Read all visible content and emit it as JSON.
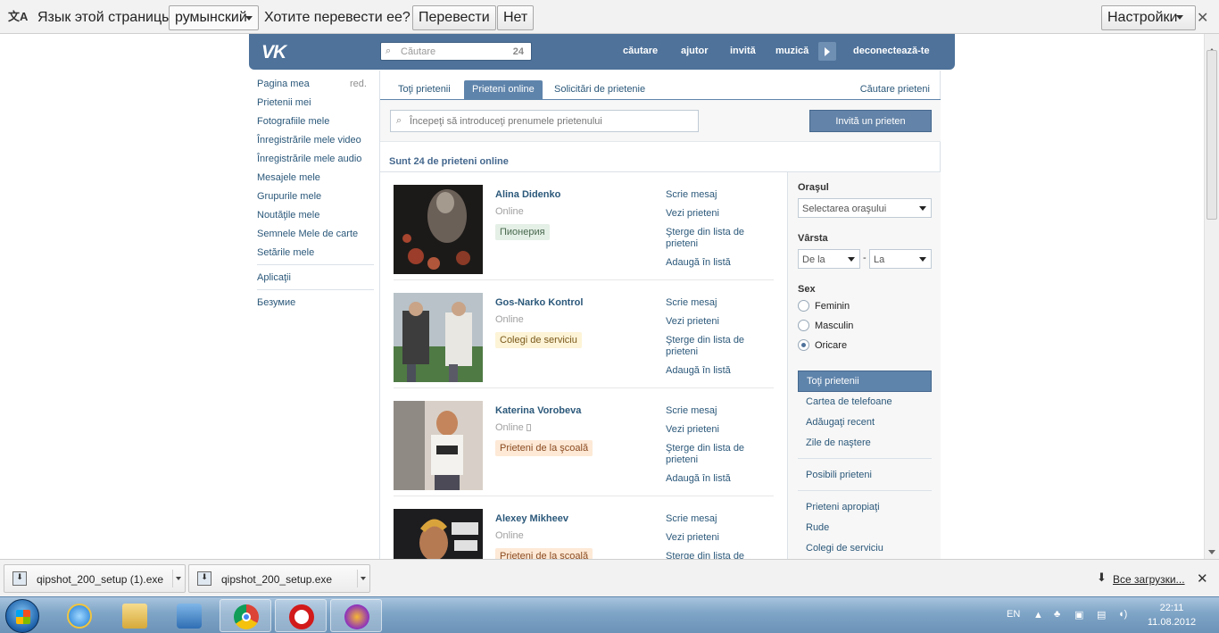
{
  "translate_bar": {
    "label": "Язык этой страницы",
    "language": "румынский",
    "question": "Хотите перевести ее?",
    "translate_btn": "Перевести",
    "no_btn": "Нет",
    "settings_btn": "Настройки",
    "close": "✕"
  },
  "header": {
    "logo": "VK",
    "search_placeholder": "Căutare",
    "search_count": "24",
    "nav": [
      "căutare",
      "ajutor",
      "invită",
      "muzică",
      "deconectează-te"
    ]
  },
  "sidebar": {
    "edit_label": "red.",
    "items": [
      "Pagina mea",
      "Prietenii mei",
      "Fotografiile mele",
      "Înregistrările mele video",
      "Înregistrările mele audio",
      "Mesajele mele",
      "Grupurile mele",
      "Noutăţile mele",
      "Semnele Mele de carte",
      "Setările mele",
      "Aplicaţii",
      "Безумие"
    ]
  },
  "tabs": {
    "items": [
      "Toţi prietenii",
      "Prieteni online",
      "Solicitări de prietenie"
    ],
    "active": "Prieteni online",
    "right": "Căutare prieteni"
  },
  "filter": {
    "placeholder": "Începeţi să introduceţi prenumele prietenului",
    "invite_btn": "Invită un prieten"
  },
  "summary": "Sunt 24 de prieteni online",
  "friends": [
    {
      "name": "Alina Didenko",
      "status": "Online",
      "tag": "Пионерия",
      "tag_bg": "#e4efe6",
      "tag_color": "#4a6a4f"
    },
    {
      "name": "Gos-Narko Kontrol",
      "status": "Online",
      "tag": "Colegi de serviciu",
      "tag_bg": "#fdf3d6",
      "tag_color": "#7a5a1c"
    },
    {
      "name": "Katerina Vorobeva",
      "status": "Online",
      "tag": "Prieteni de la şcoală",
      "tag_bg": "#fde9d6",
      "tag_color": "#8a4a20"
    },
    {
      "name": "Alexey Mikheev",
      "status": "Online",
      "tag": "Prieteni de la şcoală",
      "tag_bg": "#fde9d6",
      "tag_color": "#8a4a20"
    }
  ],
  "friend_actions": [
    "Scrie mesaj",
    "Vezi prieteni",
    "Şterge din lista de prieteni",
    "Adaugă în listă"
  ],
  "right_panel": {
    "city_label": "Oraşul",
    "city_select": "Selectarea oraşului",
    "age_label": "Vârsta",
    "age_from": "De la",
    "age_dash": "-",
    "age_to": "La",
    "sex_label": "Sex",
    "sex_options": [
      "Feminin",
      "Masculin",
      "Oricare"
    ],
    "sex_selected": "Oricare",
    "menu": [
      "Toţi prietenii",
      "Cartea de telefoane",
      "Adăugaţi recent",
      "Zile de naştere",
      "Posibili prieteni",
      "Prieteni apropiaţi",
      "Rude",
      "Colegi de serviciu"
    ],
    "menu_selected": "Toţi prietenii"
  },
  "downloads": {
    "items": [
      "qipshot_200_setup (1).exe",
      "qipshot_200_setup.exe"
    ],
    "all_link": "Все загрузки..."
  },
  "taskbar": {
    "lang": "EN",
    "time": "22:11",
    "date": "11.08.2012"
  }
}
